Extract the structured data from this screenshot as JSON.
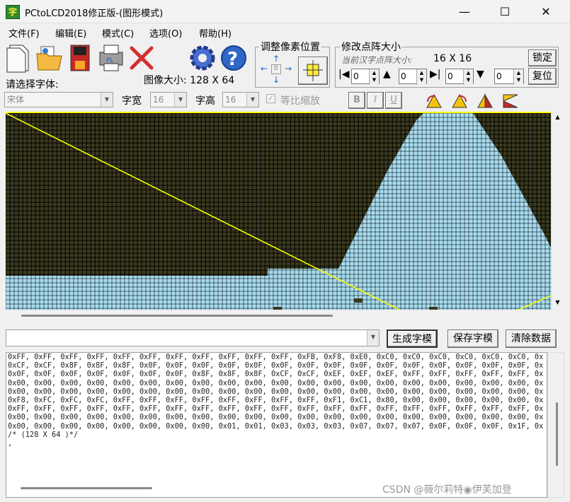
{
  "window": {
    "title": "PCtoLCD2018修正版-(图形模式)",
    "minimize": "—",
    "maximize": "☐",
    "close": "✕"
  },
  "menu": [
    "文件(F)",
    "编辑(E)",
    "模式(C)",
    "选项(O)",
    "帮助(H)"
  ],
  "toolbar": {
    "image_size_label": "图像大小: 128 X 64",
    "font_label": "请选择字体:",
    "font_value": "宋体",
    "char_width_label": "字宽",
    "char_width_value": "16",
    "char_height_label": "字高",
    "char_height_value": "16",
    "proportional_label": "等比缩放",
    "bold": "B",
    "italic": "I",
    "underline": "U"
  },
  "adjust_group": {
    "title": "调整像素位置"
  },
  "matrix_group": {
    "title": "修改点阵大小",
    "current_label": "当前汉字点阵大小:",
    "current_value": "16 X 16",
    "lock_button": "锁定",
    "reset_button": "复位",
    "spin_values": [
      "0",
      "0",
      "0",
      "0"
    ]
  },
  "actions": {
    "input_value": "",
    "generate": "生成字模",
    "save": "保存字模",
    "clear": "清除数据"
  },
  "code_lines": [
    "0xFF, 0xFF, 0xFF, 0xFF, 0xFF, 0xFF, 0xFF, 0xFF, 0xFF, 0xFF, 0xFF, 0xFB, 0xF8, 0xE0, 0xC0, 0xC0, 0xC0, 0xC0, 0xC0, 0xC0, 0x",
    "0xCF, 0xCF, 0x8F, 0x8F, 0x8F, 0x0F, 0x0F, 0x0F, 0x0F, 0x0F, 0x0F, 0x0F, 0x0F, 0x0F, 0x0F, 0x0F, 0x0F, 0x0F, 0x0F, 0x0F, 0x",
    "0x0F, 0x0F, 0x0F, 0x0F, 0x0F, 0x0F, 0x0F, 0x8F, 0x8F, 0x8F, 0xCF, 0xCF, 0xEF, 0xEF, 0xEF, 0xFF, 0xFF, 0xFF, 0xFF, 0xFF, 0x",
    "0x00, 0x00, 0x00, 0x00, 0x00, 0x00, 0x00, 0x00, 0x00, 0x00, 0x00, 0x00, 0x00, 0x00, 0x00, 0x00, 0x00, 0x00, 0x00, 0x00, 0x",
    "0x00, 0x00, 0x00, 0x00, 0x00, 0x00, 0x00, 0x00, 0x00, 0x00, 0x00, 0x00, 0x00, 0x00, 0x00, 0x00, 0x00, 0x00, 0x00, 0x00, 0x",
    "0xF8, 0xFC, 0xFC, 0xFC, 0xFF, 0xFF, 0xFF, 0xFF, 0xFF, 0xFF, 0xFF, 0xFF, 0xF1, 0xC1, 0x80, 0x00, 0x00, 0x00, 0x00, 0x00, 0x",
    "0xFF, 0xFF, 0xFF, 0xFF, 0xFF, 0xFF, 0xFF, 0xFF, 0xFF, 0xFF, 0xFF, 0xFF, 0xFF, 0xFF, 0xFF, 0xFF, 0xFF, 0xFF, 0xFF, 0xFF, 0x",
    "0x00, 0x00, 0x00, 0x00, 0x00, 0x00, 0x00, 0x00, 0x00, 0x00, 0x00, 0x00, 0x00, 0x00, 0x00, 0x00, 0x00, 0x00, 0x00, 0x00, 0x",
    "0x00, 0x00, 0x00, 0x00, 0x00, 0x00, 0x00, 0x00, 0x01, 0x01, 0x03, 0x03, 0x03, 0x07, 0x07, 0x07, 0x0F, 0x0F, 0x0F, 0x1F, 0x",
    "/* (128 X 64 )*/",
    ","
  ],
  "watermark": "CSDN @薇尔莉特◉伊芙加登",
  "colors": {
    "pixel_on": "#a8ddf0",
    "pixel_off": "#3a3a1f",
    "guide_line": "#ffff00"
  }
}
